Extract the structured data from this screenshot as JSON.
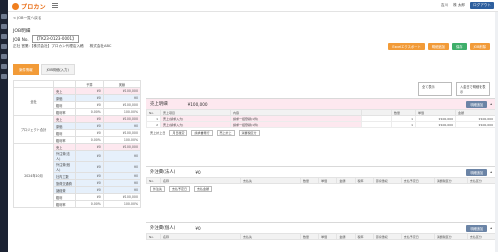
{
  "app": {
    "logo_text": "プロカン",
    "user": "吉川",
    "company": "株 太郎",
    "logout": "ログアウト"
  },
  "breadcrumb": "< JOB一覧へ戻る",
  "page": {
    "title": "JOB明細",
    "job_label": "JOB No.",
    "job_no": "【TK23-0123-0001】",
    "info": [
      "正社 営業:【株式会社】プロカン代理店入稿",
      "株式会社ABC"
    ],
    "actions": [
      {
        "label": "Excelエクスポート",
        "color": "#f29b38"
      },
      {
        "label": "明細追加",
        "color": "#f29b38"
      },
      {
        "label": "保存",
        "color": "#3eaf6a"
      },
      {
        "label": "JOB削除",
        "color": "#f29b38"
      }
    ]
  },
  "tabs": [
    {
      "label": "案件情報",
      "active": true
    },
    {
      "label": "JOB明細(入力)",
      "active": false
    }
  ],
  "filters": [
    "全て表示",
    "入金日で明細を表示"
  ],
  "summary": {
    "headers": [
      "",
      "",
      "予算",
      "実績"
    ],
    "groups": [
      {
        "name": "全社",
        "rows": [
          {
            "label": "売上",
            "budget": "¥0",
            "actual": "¥100,000",
            "tone": "pink"
          },
          {
            "label": "原価",
            "budget": "¥0",
            "actual": "¥0",
            "tone": "blue"
          },
          {
            "label": "粗利",
            "budget": "¥0",
            "actual": "¥100,000",
            "tone": "plain"
          },
          {
            "label": "粗利率",
            "budget": "0.00%",
            "actual": "100.00%",
            "tone": "plain"
          }
        ]
      },
      {
        "name": "プロジェクト合計",
        "rows": [
          {
            "label": "売上",
            "budget": "¥0",
            "actual": "¥100,000",
            "tone": "pink"
          },
          {
            "label": "原価",
            "budget": "¥0",
            "actual": "¥0",
            "tone": "blue"
          },
          {
            "label": "粗利",
            "budget": "¥0",
            "actual": "¥100,000",
            "tone": "plain"
          },
          {
            "label": "粗利率",
            "budget": "0.00%",
            "actual": "100.00%",
            "tone": "plain"
          }
        ]
      },
      {
        "name": "2024年10月",
        "rows": [
          {
            "label": "売上",
            "budget": "¥0",
            "actual": "¥100,000",
            "tone": "pink"
          },
          {
            "label": "外注費(法人)",
            "budget": "¥0",
            "actual": "¥0",
            "tone": "blue"
          },
          {
            "label": "外注費(個人)",
            "budget": "¥0",
            "actual": "¥0",
            "tone": "blue"
          },
          {
            "label": "社内工数",
            "budget": "¥0",
            "actual": "¥0",
            "tone": "blue"
          },
          {
            "label": "旅費交通費",
            "budget": "¥0",
            "actual": "¥0",
            "tone": "blue"
          },
          {
            "label": "諸経費",
            "budget": "¥0",
            "actual": "¥0",
            "tone": "blue"
          },
          {
            "label": "粗利",
            "budget": "¥0",
            "actual": "¥100,000",
            "tone": "plain"
          },
          {
            "label": "粗利率",
            "budget": "0.00%",
            "actual": "100.00%",
            "tone": "plain"
          }
        ]
      }
    ]
  },
  "sales_panel": {
    "title": "売上明細",
    "amount": "¥100,000",
    "button": "明細追加",
    "columns": [
      "No.",
      "売上項目",
      "内容",
      "",
      "数量",
      "単価",
      "金額"
    ],
    "rows": [
      {
        "no": "1",
        "item": "売上(請求入力)",
        "content": "請求一括登録(1件)",
        "qty": "1",
        "price": "¥100,000",
        "amount": "¥100,000"
      },
      {
        "no": "2",
        "item": "売上(請求入力)",
        "content": "請求一括登録(1件)",
        "qty": "1",
        "price": "¥100,000",
        "amount": "¥100,000"
      }
    ],
    "addbar": [
      "売上計上日",
      "月日確定",
      "請求書発行",
      "売上計上",
      "消費税区分"
    ]
  },
  "outsource_corp": {
    "title": "外注費(法人)",
    "amount": "¥0",
    "button": "明細追加",
    "columns": [
      "No.",
      "名称",
      "支払先",
      "数量",
      "単価",
      "金額",
      "税率",
      "源泉徴収",
      "支払予定日",
      "消費税区分",
      "支払区分"
    ],
    "addbar": [
      "外注先",
      "支払予定日",
      "支払金額"
    ]
  },
  "outsource_ind": {
    "title": "外注費(個人)",
    "amount": "¥0",
    "button": "明細追加",
    "columns": [
      "No.",
      "名称",
      "支払先",
      "数量",
      "単価",
      "金額",
      "税率",
      "源泉徴収",
      "支払予定日",
      "消費税区分",
      "支払区分"
    ]
  }
}
